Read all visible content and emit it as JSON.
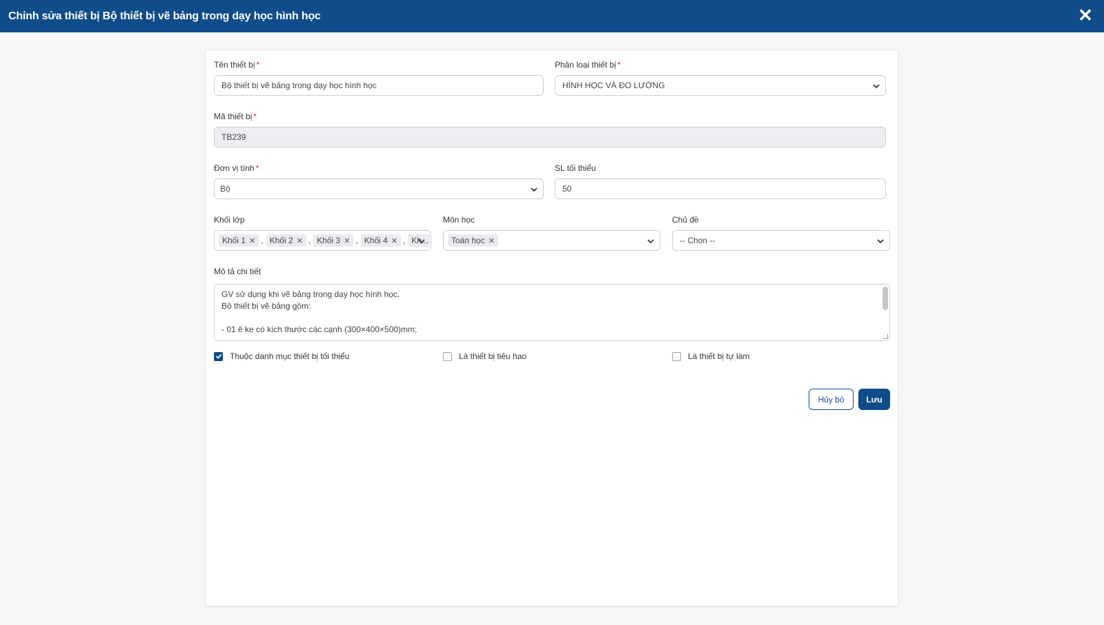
{
  "header": {
    "title": "Chỉnh sửa thiết bị Bộ thiết bị vẽ bảng trong dạy học hình học"
  },
  "form": {
    "device_name": {
      "label": "Tên thiết bị",
      "required_mark": "*",
      "value": "Bộ thiết bị vẽ bảng trong dạy học hình học"
    },
    "category": {
      "label": "Phân loại thiết bị",
      "required_mark": "*",
      "value": "HÌNH HỌC VÀ ĐO LƯỜNG"
    },
    "device_code": {
      "label": "Mã thiết bị",
      "required_mark": "*",
      "value": "TB239"
    },
    "unit": {
      "label": "Đơn vị tính",
      "required_mark": "*",
      "value": "Bộ"
    },
    "min_qty": {
      "label": "SL tối thiểu",
      "value": "50"
    },
    "grade": {
      "label": "Khối lớp",
      "tags": [
        "Khối 1",
        "Khối 2",
        "Khối 3",
        "Khối 4"
      ],
      "overflow": "Kh...",
      "separator": ","
    },
    "subject": {
      "label": "Môn học",
      "tags": [
        "Toán học"
      ]
    },
    "topic": {
      "label": "Chủ đề",
      "value": "-- Chọn --"
    },
    "description": {
      "label": "Mô tả chi tiết",
      "lines": [
        "GV sử dụng khi vẽ bảng trong dạy học hình học.",
        "Bộ thiết bị vẽ bảng gồm:",
        "",
        "- 01 ê ke có kích thước các cạnh (300×400×500)mm;"
      ]
    },
    "checkboxes": [
      {
        "label": "Thuộc danh mục thiết bị tối thiểu",
        "checked": true
      },
      {
        "label": "Là thiết bị tiêu hao",
        "checked": false
      },
      {
        "label": "Là thiết bị tự làm",
        "checked": false
      }
    ]
  },
  "actions": {
    "cancel_label": "Hủy bỏ",
    "save_label": "Lưu"
  },
  "colors": {
    "primary": "#0f4c8a",
    "required": "#e02424"
  },
  "icons": {
    "close": "close-icon",
    "dropdown": "chevron-down-icon",
    "remove_tag": "x-icon",
    "check": "check-icon"
  }
}
